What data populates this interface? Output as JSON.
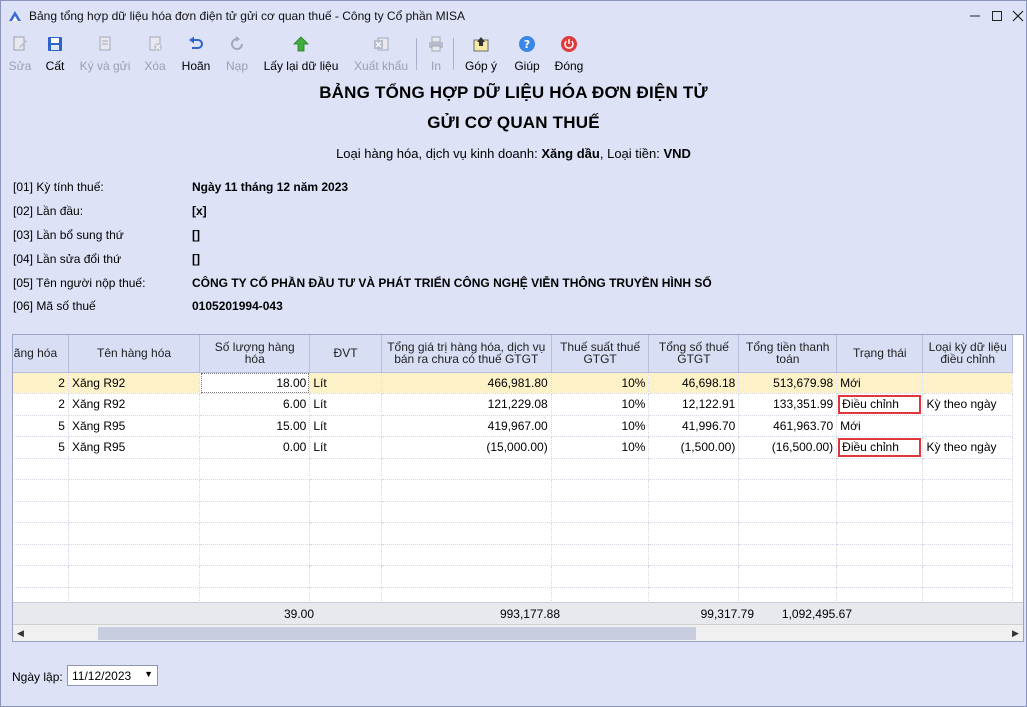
{
  "window": {
    "title": "Bảng tổng hợp dữ liệu hóa đơn điện tử gửi cơ quan thuế - Công ty Cổ phần MISA"
  },
  "toolbar": {
    "items": [
      {
        "label": "Sửa",
        "icon": "edit-icon",
        "enabled": false
      },
      {
        "label": "Cất",
        "icon": "save-icon",
        "enabled": true
      },
      {
        "label": "Ký và gửi",
        "icon": "sign-send-icon",
        "enabled": false
      },
      {
        "label": "Xóa",
        "icon": "delete-icon",
        "enabled": false
      },
      {
        "label": "Hoãn",
        "icon": "undo-icon",
        "enabled": true
      },
      {
        "label": "Nạp",
        "icon": "reload-icon",
        "enabled": false
      },
      {
        "label": "Lấy lại dữ liệu",
        "icon": "arrow-up-icon",
        "enabled": true
      },
      {
        "label": "Xuất khẩu",
        "icon": "excel-export-icon",
        "enabled": false
      },
      {
        "label": "In",
        "icon": "print-icon",
        "enabled": false
      },
      {
        "label": "Góp ý",
        "icon": "feedback-icon",
        "enabled": true
      },
      {
        "label": "Giúp",
        "icon": "help-icon",
        "enabled": true
      },
      {
        "label": "Đóng",
        "icon": "power-icon",
        "enabled": true
      }
    ]
  },
  "report": {
    "title_line1": "BẢNG TỔNG HỢP DỮ LIỆU HÓA ĐƠN ĐIỆN TỬ",
    "title_line2": "GỬI CƠ QUAN THUẾ",
    "goods_label": "Loại hàng hóa, dịch vụ kinh doanh: ",
    "goods_value": "Xăng dầu",
    "currency_label": ", Loại tiền: ",
    "currency_value": "VND",
    "info": [
      {
        "label": "[01] Kỳ tính thuế:",
        "value": "Ngày 11 tháng 12 năm 2023"
      },
      {
        "label": "[02] Lần đầu:",
        "value": "[x]"
      },
      {
        "label": "[03] Lần bổ sung thứ",
        "value": "[]"
      },
      {
        "label": "[04] Lần sửa đổi thứ",
        "value": "[]"
      },
      {
        "label": "[05] Tên người nộp thuế:",
        "value": "CÔNG TY CỔ PHẦN ĐẦU TƯ VÀ PHÁT TRIỂN CÔNG NGHỆ VIỄN THÔNG TRUYỀN HÌNH SỐ"
      },
      {
        "label": "[06] Mã số thuế",
        "value": "0105201994-043"
      }
    ]
  },
  "grid": {
    "columns": [
      "ãng hóa",
      "Tên hàng hóa",
      "Số lượng hàng hóa",
      "ĐVT",
      "Tổng giá trị hàng hóa, dịch vụ bán ra chưa có thuế GTGT",
      "Thuế suất thuế GTGT",
      "Tổng số thuế GTGT",
      "Tổng tiền thanh toán",
      "Trạng thái",
      "Loại kỳ dữ liệu điều chỉnh"
    ],
    "rows": [
      {
        "code": "2",
        "name": "Xăng R92",
        "qty": "18.00",
        "unit": "Lít",
        "amount": "466,981.80",
        "rate": "10%",
        "tax": "46,698.18",
        "total": "513,679.98",
        "status": "Mới",
        "period": ""
      },
      {
        "code": "2",
        "name": "Xăng R92",
        "qty": "6.00",
        "unit": "Lít",
        "amount": "121,229.08",
        "rate": "10%",
        "tax": "12,122.91",
        "total": "133,351.99",
        "status": "Điều chỉnh",
        "period": "Kỳ theo ngày"
      },
      {
        "code": "5",
        "name": "Xăng R95",
        "qty": "15.00",
        "unit": "Lít",
        "amount": "419,967.00",
        "rate": "10%",
        "tax": "41,996.70",
        "total": "461,963.70",
        "status": "Mới",
        "period": ""
      },
      {
        "code": "5",
        "name": "Xăng R95",
        "qty": "0.00",
        "unit": "Lít",
        "amount": "(15,000.00)",
        "rate": "10%",
        "tax": "(1,500.00)",
        "total": "(16,500.00)",
        "status": "Điều chỉnh",
        "period": "Kỳ theo ngày"
      }
    ],
    "totals": {
      "qty": "39.00",
      "amount": "993,177.88",
      "tax": "99,317.79",
      "total": "1,092,495.67"
    }
  },
  "footer": {
    "date_label": "Ngày lập:",
    "date_value": "11/12/2023"
  },
  "colors": {
    "background": "#dde2f7",
    "selected_row": "#fdf1c7",
    "highlight_border": "#e0373d",
    "header_bg": "#d8dff5"
  }
}
